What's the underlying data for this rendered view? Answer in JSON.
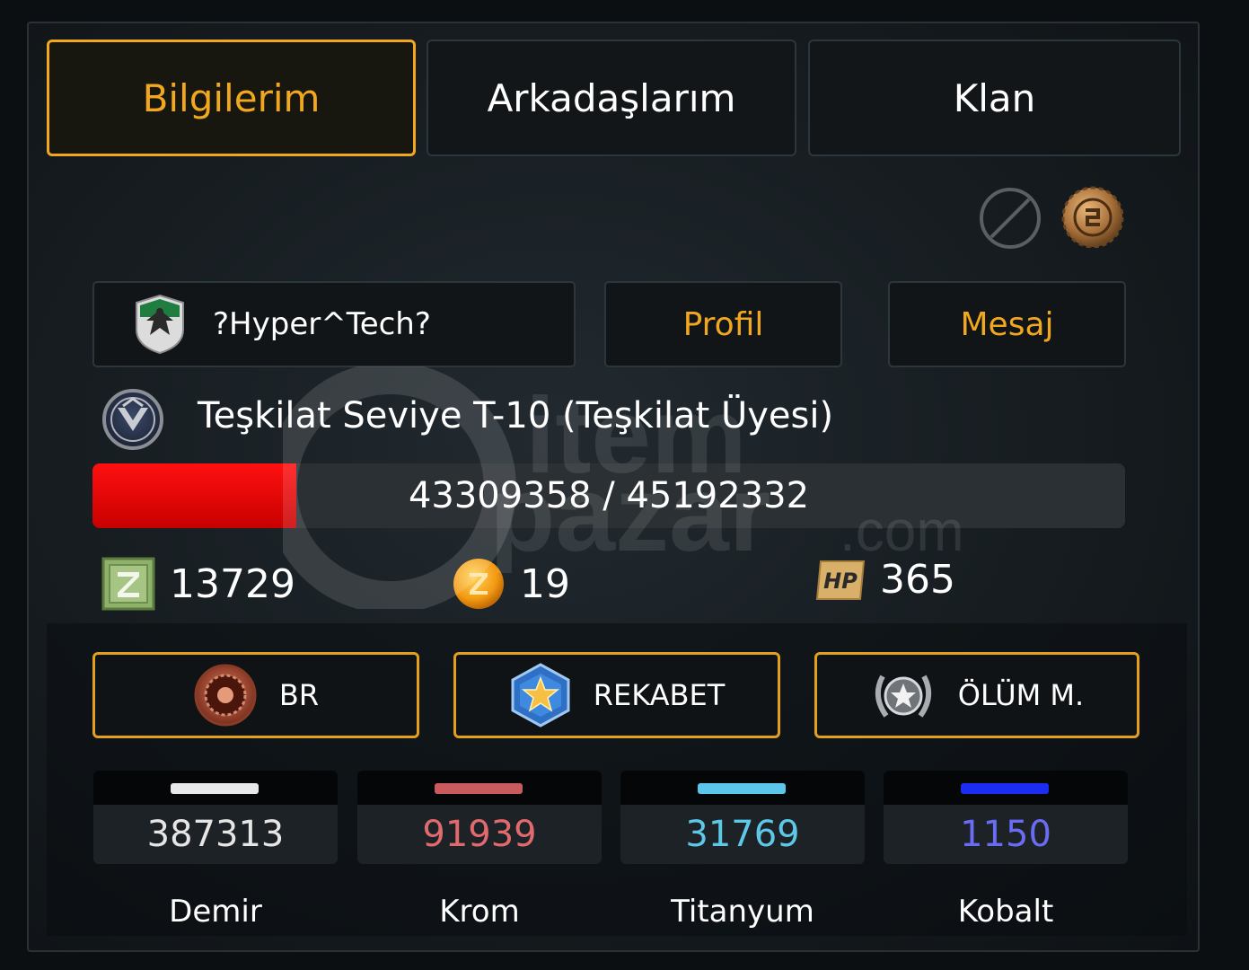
{
  "tabs": [
    {
      "label": "Bilgilerim",
      "active": true
    },
    {
      "label": "Arkadaşlarım",
      "active": false
    },
    {
      "label": "Klan",
      "active": false
    }
  ],
  "top_icons": [
    "block-icon",
    "gold-medal-icon"
  ],
  "player": {
    "name": "?Hyper^Tech?",
    "emblem_icon": "eagle-emblem-icon",
    "profile_label": "Profil",
    "message_label": "Mesaj"
  },
  "rank": {
    "icon": "rank-badge-icon",
    "text": "Teşkilat Seviye T-10 (Teşkilat Üyesi)",
    "progress_text": "43309358 / 45192332",
    "progress_fraction": 0.197
  },
  "currencies": [
    {
      "icon": "z-crate-icon",
      "value": "13729"
    },
    {
      "icon": "z-coin-icon",
      "value": "19"
    },
    {
      "icon": "hp-icon",
      "value": "365",
      "icon_text": "HP"
    }
  ],
  "modes": [
    {
      "label": "BR",
      "icon": "br-emblem-icon"
    },
    {
      "label": "REKABET",
      "icon": "star-hexagon-icon"
    },
    {
      "label": "ÖLÜM M.",
      "icon": "laurel-star-icon"
    }
  ],
  "resources": [
    {
      "label": "Demir",
      "value": "387313",
      "color": "#e6e6e6",
      "bar_color": "#e8e8e8"
    },
    {
      "label": "Krom",
      "value": "91939",
      "color": "#e06a6e",
      "bar_color": "#c95a5e"
    },
    {
      "label": "Titanyum",
      "value": "31769",
      "color": "#5ec8e8",
      "bar_color": "#5cc6ea"
    },
    {
      "label": "Kobalt",
      "value": "1150",
      "color": "#6a6cf4",
      "bar_color": "#1a2df0"
    }
  ],
  "watermark": {
    "text_top": "item",
    "text_bottom": "pazar",
    "suffix": ".com"
  }
}
